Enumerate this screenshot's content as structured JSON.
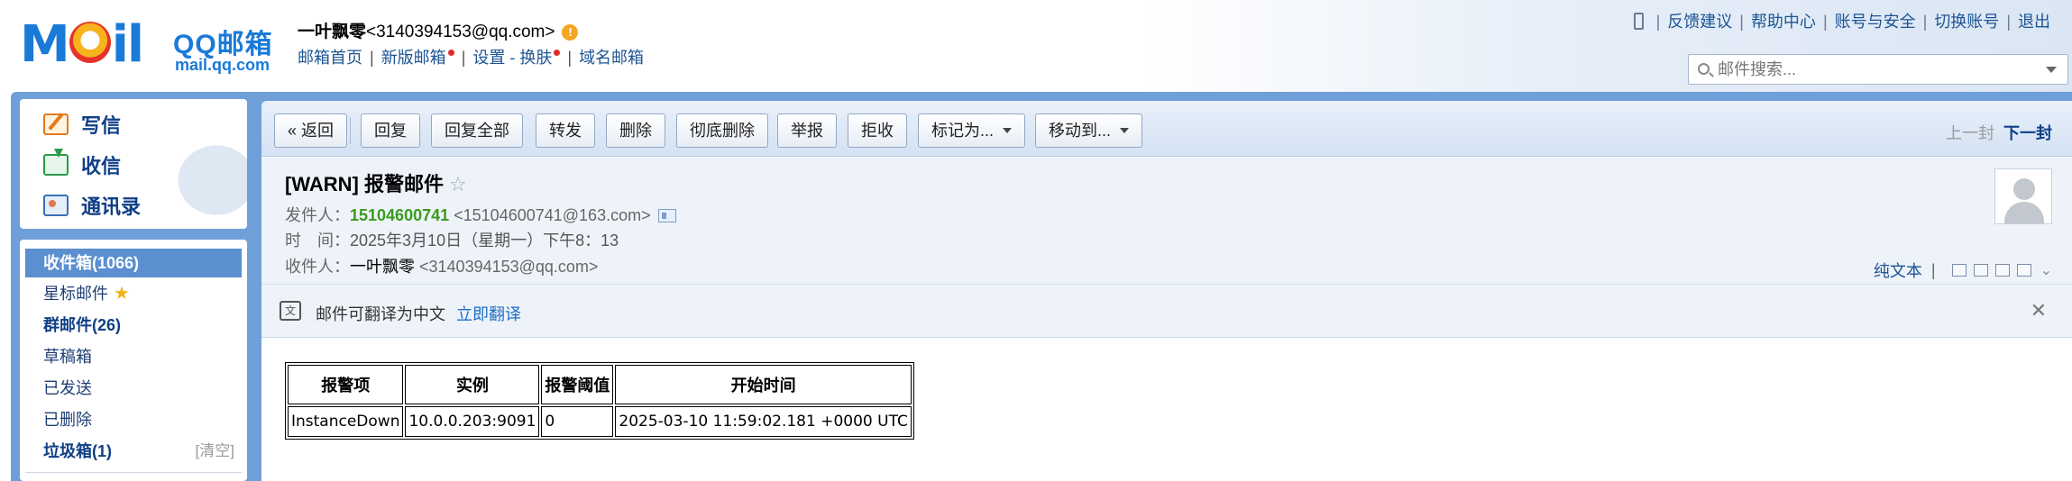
{
  "header": {
    "logo": {
      "main": "Mail",
      "cn": "QQ邮箱",
      "url": "mail.qq.com"
    },
    "user": {
      "name": "一叶飘零",
      "email": "<3140394153@qq.com>",
      "warn_glyph": "!"
    },
    "links": [
      {
        "label": "邮箱首页",
        "dot": false
      },
      {
        "label": "新版邮箱",
        "dot": true
      },
      {
        "label": "设置 - 换肤",
        "dot": true
      },
      {
        "label": "域名邮箱",
        "dot": false
      }
    ],
    "right_links": [
      "反馈建议",
      "帮助中心",
      "账号与安全",
      "切换账号",
      "退出"
    ],
    "search": {
      "placeholder": "邮件搜索..."
    }
  },
  "sidebar": {
    "actions": [
      {
        "label": "写信",
        "icon": "compose-icon"
      },
      {
        "label": "收信",
        "icon": "inbox-download-icon"
      },
      {
        "label": "通讯录",
        "icon": "contacts-icon"
      }
    ],
    "folders": [
      {
        "label": "收件箱(1066)",
        "active": true,
        "bold": true
      },
      {
        "label": "星标邮件",
        "star": "★"
      },
      {
        "label": "群邮件(26)",
        "bold": true
      },
      {
        "label": "草稿箱"
      },
      {
        "label": "已发送"
      },
      {
        "label": "已删除"
      },
      {
        "label": "垃圾箱(1)",
        "bold": true,
        "extra": "[清空]"
      }
    ]
  },
  "toolbar": {
    "back": "« 返回",
    "buttons": [
      "回复",
      "回复全部",
      "转发",
      "删除",
      "彻底删除",
      "举报",
      "拒收"
    ],
    "dropdowns": [
      "标记为...",
      "移动到..."
    ],
    "prev": "上一封",
    "next": "下一封"
  },
  "mail": {
    "subject": "[WARN] 报警邮件",
    "star_glyph": "☆",
    "from_label": "发件人：",
    "from_name": "15104600741",
    "from_addr": "<15104600741@163.com>",
    "time_label": "时　间：",
    "time_value": "2025年3月10日（星期一）下午8：13",
    "to_label": "收件人：",
    "to_name": "一叶飘零",
    "to_addr": "<3140394153@qq.com>",
    "plain_text": "纯文本",
    "translate_text": "邮件可翻译为中文",
    "translate_link": "立即翻译",
    "close_glyph": "✕",
    "translate_glyph": "文"
  },
  "alert_table": {
    "headers": [
      "报警项",
      "实例",
      "报警阈值",
      "开始时间"
    ],
    "rows": [
      [
        "InstanceDown",
        "10.0.0.203:9091",
        "0",
        "2025-03-10 11:59:02.181 +0000 UTC"
      ]
    ]
  }
}
